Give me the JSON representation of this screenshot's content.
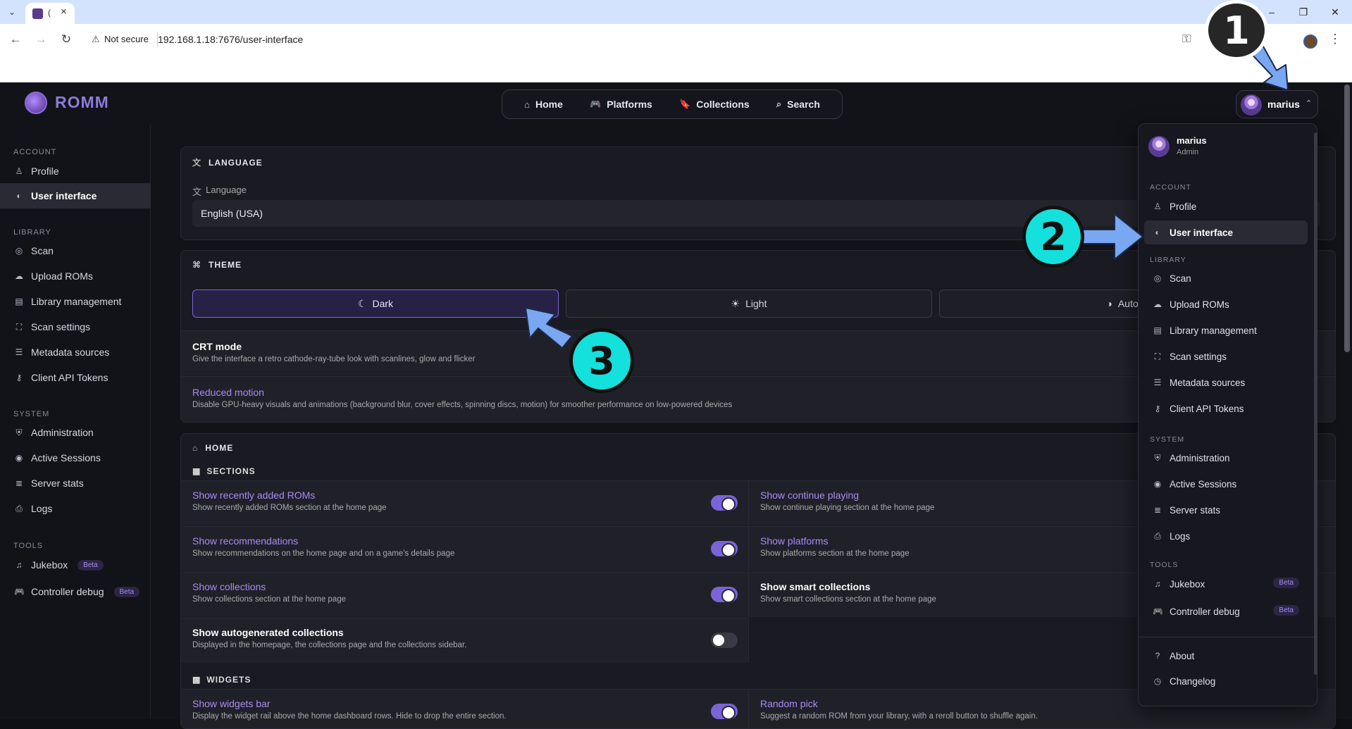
{
  "browser": {
    "tab_title": "(",
    "security_label": "Not secure",
    "url": "192.168.1.18:7676/user-interface"
  },
  "app": {
    "logo_text": "ROMM",
    "nav": [
      {
        "label": "Home",
        "icon": "home-icon"
      },
      {
        "label": "Platforms",
        "icon": "gamepad-icon"
      },
      {
        "label": "Collections",
        "icon": "bookmark-icon"
      },
      {
        "label": "Search",
        "icon": "search-icon"
      }
    ],
    "user": {
      "name": "marius",
      "role": "Admin"
    }
  },
  "sidebar": {
    "sections": [
      "ACCOUNT",
      "LIBRARY",
      "SYSTEM",
      "TOOLS"
    ],
    "items": [
      {
        "label": "Profile",
        "icon": "user-icon"
      },
      {
        "label": "User interface",
        "icon": "palette-icon"
      },
      {
        "label": "Scan",
        "icon": "radar-icon"
      },
      {
        "label": "Upload ROMs",
        "icon": "cloud-upload-icon"
      },
      {
        "label": "Library management",
        "icon": "library-icon"
      },
      {
        "label": "Scan settings",
        "icon": "scan-icon"
      },
      {
        "label": "Metadata sources",
        "icon": "database-icon"
      },
      {
        "label": "Client API Tokens",
        "icon": "key-icon"
      },
      {
        "label": "Administration",
        "icon": "shield-icon"
      },
      {
        "label": "Active Sessions",
        "icon": "broadcast-icon"
      },
      {
        "label": "Server stats",
        "icon": "server-icon"
      },
      {
        "label": "Logs",
        "icon": "log-icon"
      },
      {
        "label": "Jukebox",
        "icon": "music-icon"
      },
      {
        "label": "Controller debug",
        "icon": "gamepad-icon"
      }
    ],
    "beta_label": "Beta"
  },
  "language": {
    "heading": "LANGUAGE",
    "field_label": "Language",
    "value": "English (USA)"
  },
  "theme": {
    "heading": "THEME",
    "options": [
      "Dark",
      "Light",
      "Auto"
    ],
    "selected": "Dark",
    "crt_title": "CRT mode",
    "crt_desc": "Give the interface a retro cathode-ray-tube look with scanlines, glow and flicker",
    "reduced_title": "Reduced motion",
    "reduced_desc": "Disable GPU-heavy visuals and animations (background blur, cover effects, spinning discs, motion) for smoother performance on low-powered devices"
  },
  "home": {
    "heading": "HOME",
    "sections_heading": "SECTIONS",
    "widgets_heading": "WIDGETS",
    "left": [
      {
        "title": "Show recently added ROMs",
        "desc": "Show recently added ROMs section at the home page",
        "on": true
      },
      {
        "title": "Show recommendations",
        "desc": "Show recommendations on the home page and on a game's details page",
        "on": true
      },
      {
        "title": "Show collections",
        "desc": "Show collections section at the home page",
        "on": true
      },
      {
        "title": "Show autogenerated collections",
        "desc": "Displayed in the homepage, the collections page and the collections sidebar.",
        "on": false
      }
    ],
    "right": [
      {
        "title": "Show continue playing",
        "desc": "Show continue playing section at the home page"
      },
      {
        "title": "Show platforms",
        "desc": "Show platforms section at the home page"
      },
      {
        "title": "Show smart collections",
        "desc": "Show smart collections section at the home page"
      }
    ],
    "widgets_left": {
      "title": "Show widgets bar",
      "desc": "Display the widget rail above the home dashboard rows. Hide to drop the entire section."
    },
    "widgets_right": {
      "title": "Random pick",
      "desc": "Suggest a random ROM from your library, with a reroll button to shuffle again."
    }
  },
  "menu": {
    "sections": [
      "ACCOUNT",
      "LIBRARY",
      "SYSTEM",
      "TOOLS"
    ],
    "items": [
      "Profile",
      "User interface",
      "Scan",
      "Upload ROMs",
      "Library management",
      "Scan settings",
      "Metadata sources",
      "Client API Tokens",
      "Administration",
      "Active Sessions",
      "Server stats",
      "Logs",
      "Jukebox",
      "Controller debug",
      "About",
      "Changelog"
    ],
    "beta_label": "Beta"
  },
  "annotations": [
    "1",
    "2",
    "3"
  ]
}
